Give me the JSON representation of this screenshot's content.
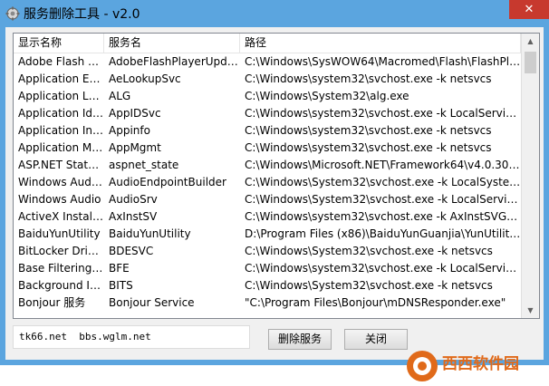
{
  "window": {
    "title": "服务删除工具 - v2.0",
    "close": "✕"
  },
  "columns": [
    "显示名称",
    "服务名",
    "路径"
  ],
  "rows": [
    [
      "Adobe Flash Pl...",
      "AdobeFlashPlayerUpdat...",
      "C:\\Windows\\SysWOW64\\Macromed\\Flash\\FlashPlay..."
    ],
    [
      "Application Exp...",
      "AeLookupSvc",
      "C:\\Windows\\system32\\svchost.exe -k netsvcs"
    ],
    [
      "Application Lay...",
      "ALG",
      "C:\\Windows\\System32\\alg.exe"
    ],
    [
      "Application Ide...",
      "AppIDSvc",
      "C:\\Windows\\system32\\svchost.exe -k LocalServiceAn..."
    ],
    [
      "Application Inf...",
      "Appinfo",
      "C:\\Windows\\system32\\svchost.exe -k netsvcs"
    ],
    [
      "Application Ma...",
      "AppMgmt",
      "C:\\Windows\\system32\\svchost.exe -k netsvcs"
    ],
    [
      "ASP.NET State ...",
      "aspnet_state",
      "C:\\Windows\\Microsoft.NET\\Framework64\\v4.0.30319..."
    ],
    [
      "Windows Audi...",
      "AudioEndpointBuilder",
      "C:\\Windows\\System32\\svchost.exe -k LocalSystemNe..."
    ],
    [
      "Windows Audio",
      "AudioSrv",
      "C:\\Windows\\System32\\svchost.exe -k LocalServiceNe..."
    ],
    [
      "ActiveX Installe...",
      "AxInstSV",
      "C:\\Windows\\system32\\svchost.exe -k AxInstSVGroup"
    ],
    [
      "BaiduYunUtility",
      "BaiduYunUtility",
      "D:\\Program Files (x86)\\BaiduYunGuanjia\\YunUtilitySe..."
    ],
    [
      "BitLocker Drive ...",
      "BDESVC",
      "C:\\Windows\\System32\\svchost.exe -k netsvcs"
    ],
    [
      "Base Filtering E...",
      "BFE",
      "C:\\Windows\\system32\\svchost.exe -k LocalServiceNo..."
    ],
    [
      "Background Int...",
      "BITS",
      "C:\\Windows\\System32\\svchost.exe -k netsvcs"
    ],
    [
      "Bonjour 服务",
      "Bonjour Service",
      "\"C:\\Program Files\\Bonjour\\mDNSResponder.exe\""
    ]
  ],
  "status_text": "tk66.net  bbs.wglm.net",
  "buttons": {
    "delete": "删除服务",
    "close": "关闭"
  },
  "watermark": {
    "brand": "西西软件园",
    "url": "CR173.COM"
  },
  "colors": {
    "titlebar": "#5ba5df",
    "close": "#c7392e",
    "watermark": "#e06a1a"
  }
}
